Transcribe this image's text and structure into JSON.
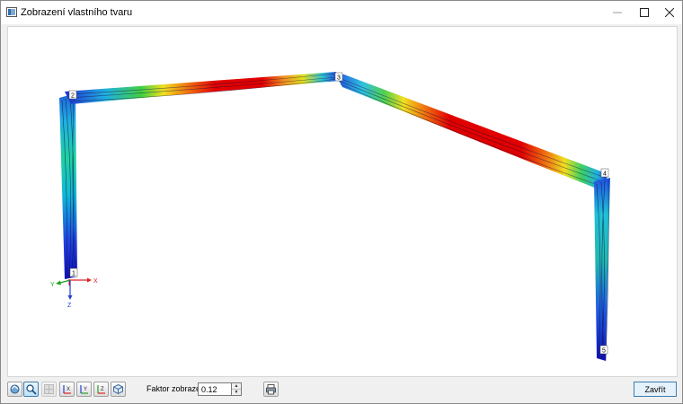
{
  "window": {
    "title": "Zobrazení vlastního tvaru",
    "min_icon": "minimize-icon",
    "max_icon": "maximize-icon",
    "close_icon": "close-icon"
  },
  "viewport": {
    "node_labels": [
      "1",
      "2",
      "3",
      "4",
      "5"
    ],
    "axes": {
      "x": "X",
      "y": "Y",
      "z": "Z"
    },
    "colors": {
      "axis_x": "#e02020",
      "axis_y": "#20a020",
      "axis_z": "#2040d0",
      "member_low": "#1010c0",
      "member_high": "#e00000"
    }
  },
  "toolbar": {
    "buttons": [
      {
        "name": "view-rotate-icon"
      },
      {
        "name": "zoom-icon"
      },
      {
        "name": "grid-icon"
      },
      {
        "name": "view-x-icon"
      },
      {
        "name": "view-y-icon"
      },
      {
        "name": "view-z-icon"
      },
      {
        "name": "isometric-view-icon"
      }
    ],
    "factor_label": "Faktor zobrazení:",
    "factor_value": "0.12",
    "print_icon": "print-icon",
    "close_label": "Zavřít"
  }
}
